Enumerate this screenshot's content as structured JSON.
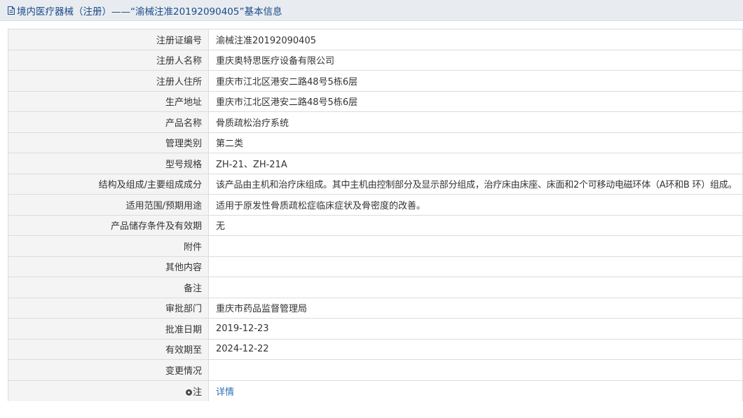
{
  "header": {
    "title": "境内医疗器械（注册）——“渝械注准20192090405”基本信息",
    "icon": "document-icon"
  },
  "rows": [
    {
      "label": "注册证编号",
      "value": "渝械注准20192090405"
    },
    {
      "label": "注册人名称",
      "value": "重庆奥特思医疗设备有限公司"
    },
    {
      "label": "注册人住所",
      "value": "重庆市江北区港安二路48号5栋6层"
    },
    {
      "label": "生产地址",
      "value": "重庆市江北区港安二路48号5栋6层"
    },
    {
      "label": "产品名称",
      "value": "骨质疏松治疗系统"
    },
    {
      "label": "管理类别",
      "value": "第二类"
    },
    {
      "label": "型号规格",
      "value": "ZH-21、ZH-21A"
    },
    {
      "label": "结构及组成/主要组成成分",
      "value": "该产品由主机和治疗床组成。其中主机由控制部分及显示部分组成，治疗床由床座、床面和2个可移动电磁环体（A环和B 环）组成。"
    },
    {
      "label": "适用范围/预期用途",
      "value": "适用于原发性骨质疏松症临床症状及骨密度的改善。"
    },
    {
      "label": "产品储存条件及有效期",
      "value": "无"
    },
    {
      "label": "附件",
      "value": ""
    },
    {
      "label": "其他内容",
      "value": ""
    },
    {
      "label": "备注",
      "value": ""
    },
    {
      "label": "审批部门",
      "value": "重庆市药品监督管理局"
    },
    {
      "label": "批准日期",
      "value": "2019-12-23"
    },
    {
      "label": "有效期至",
      "value": "2024-12-22"
    },
    {
      "label": "变更情况",
      "value": ""
    }
  ],
  "note": {
    "label": "注",
    "link": "详情",
    "icon": "note-bullet-icon"
  },
  "colors": {
    "title_text": "#1b4a86",
    "title_bg": "#e8ecf1",
    "label_bg": "#f4f4f4",
    "border": "#dcdcdc",
    "link": "#2d6db5"
  }
}
